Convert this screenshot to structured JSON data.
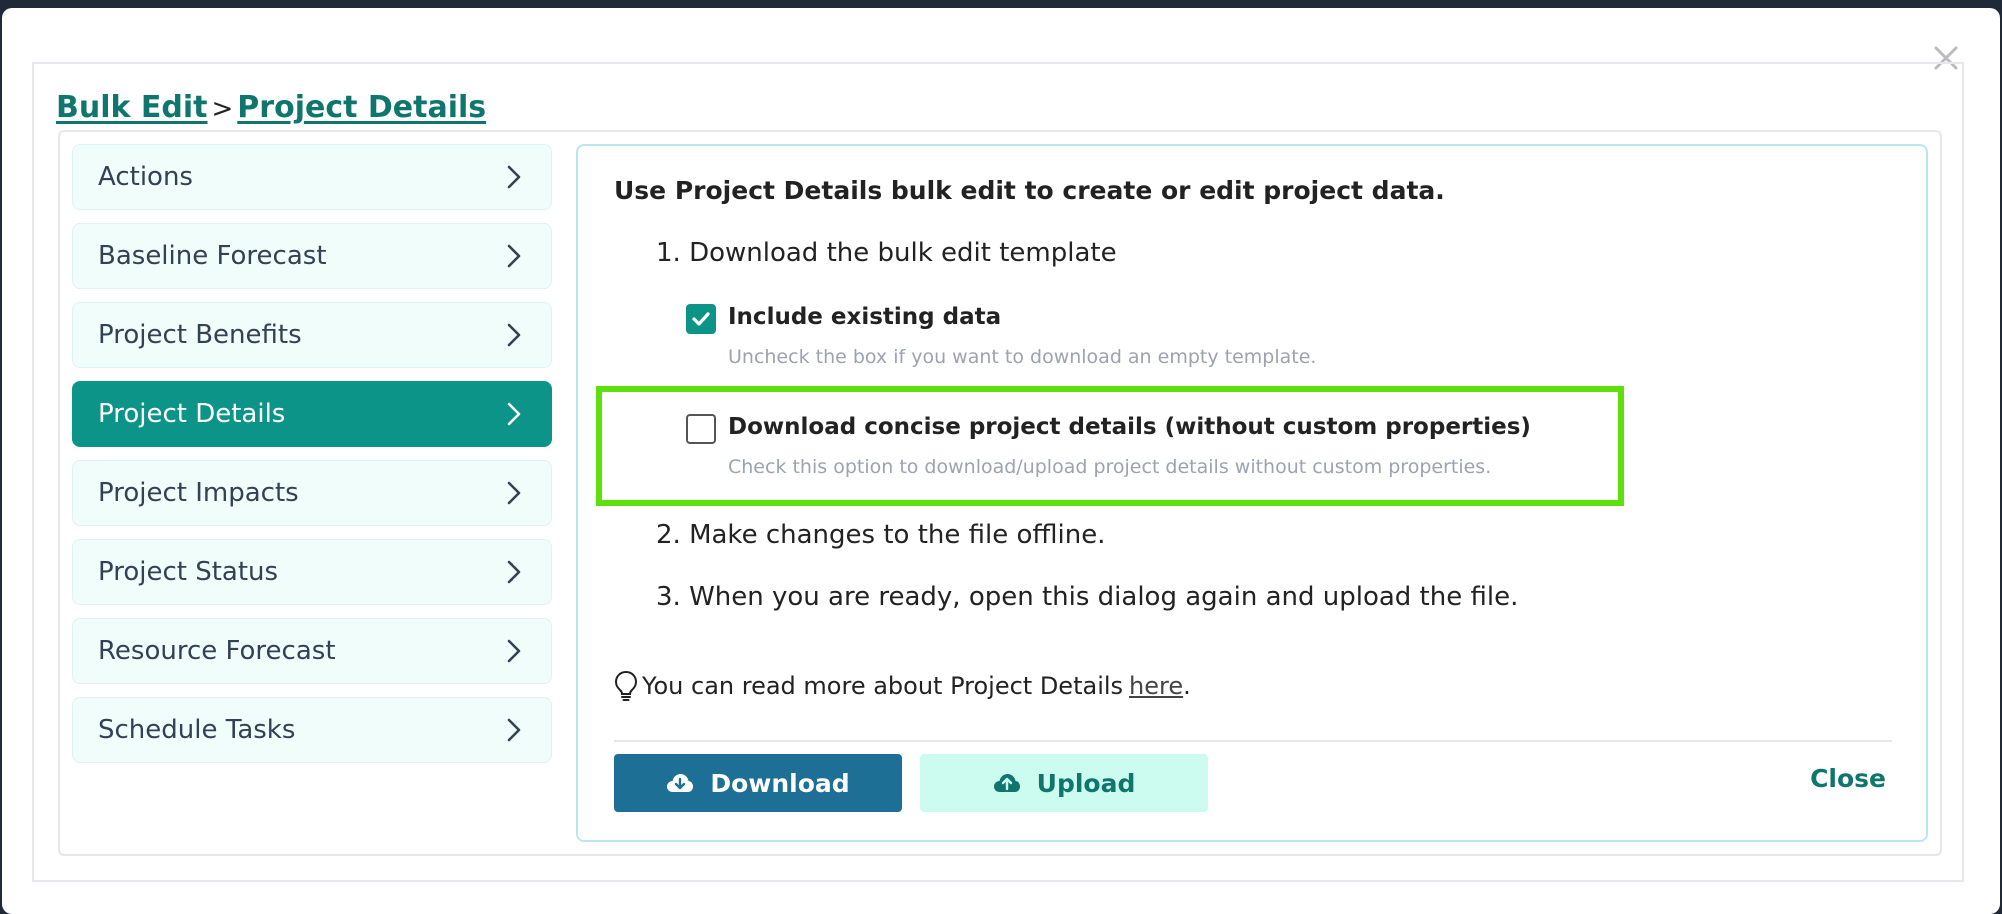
{
  "breadcrumb": {
    "root": "Bulk Edit",
    "separator": ">",
    "current": "Project Details"
  },
  "sidebar": {
    "items": [
      {
        "label": "Actions",
        "active": false
      },
      {
        "label": "Baseline Forecast",
        "active": false
      },
      {
        "label": "Project Benefits",
        "active": false
      },
      {
        "label": "Project Details",
        "active": true
      },
      {
        "label": "Project Impacts",
        "active": false
      },
      {
        "label": "Project Status",
        "active": false
      },
      {
        "label": "Resource Forecast",
        "active": false
      },
      {
        "label": "Schedule Tasks",
        "active": false
      }
    ]
  },
  "panel": {
    "title": "Use Project Details bulk edit to create or edit project data.",
    "step1": "1. Download the bulk edit template",
    "option_existing": {
      "label": "Include existing data",
      "help": "Uncheck the box if you want to download an empty template.",
      "checked": true
    },
    "option_concise": {
      "label": "Download concise project details (without custom properties)",
      "help": "Check this option to download/upload project details without custom properties.",
      "checked": false
    },
    "step2": "2. Make changes to the file offline.",
    "step3": "3. When you are ready, open this dialog again and upload the file.",
    "tip_text": "You can read more about Project Details",
    "tip_link": "here",
    "tip_end": "."
  },
  "buttons": {
    "download": "Download",
    "upload": "Upload",
    "close": "Close"
  },
  "icons": {
    "close": "close-icon",
    "chevron": "chevron-right-icon",
    "check": "check-icon",
    "tip": "lightbulb-icon",
    "download": "cloud-download-icon",
    "upload": "cloud-upload-icon"
  },
  "colors": {
    "accent": "#0d9488",
    "link": "#0f766e",
    "download_bg": "#1d6f96",
    "upload_bg": "#ccfbef",
    "highlight": "#5ee00c"
  }
}
